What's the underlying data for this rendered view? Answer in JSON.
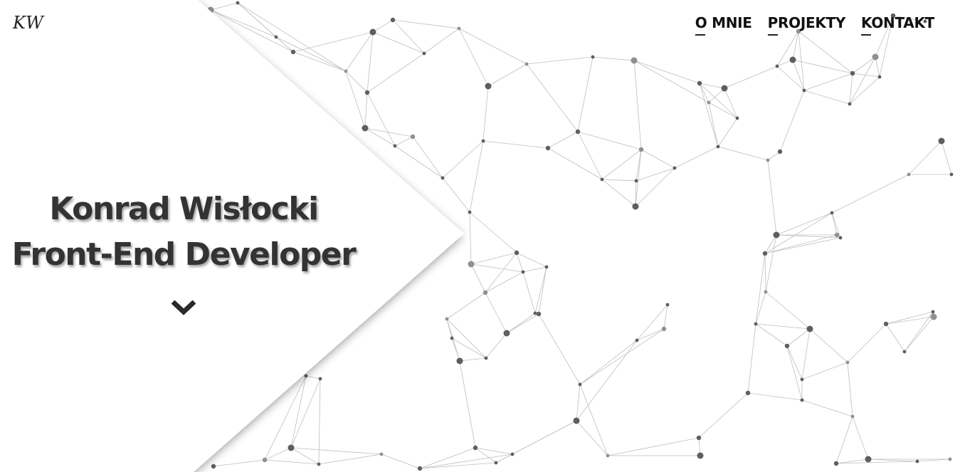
{
  "header": {
    "logo_text": "KW",
    "nav": {
      "items": [
        {
          "label": "O MNIE"
        },
        {
          "label": "PROJEKTY"
        },
        {
          "label": "KONTAKT"
        }
      ]
    }
  },
  "hero": {
    "name": "Konrad Wisłocki",
    "role": "Front-End Developer",
    "scroll_icon": "chevron-down-icon"
  },
  "colors": {
    "text": "#333333",
    "nav_text": "#111111",
    "network_line": "#9a9a9a",
    "network_node": "#666666",
    "background": "#ffffff"
  }
}
